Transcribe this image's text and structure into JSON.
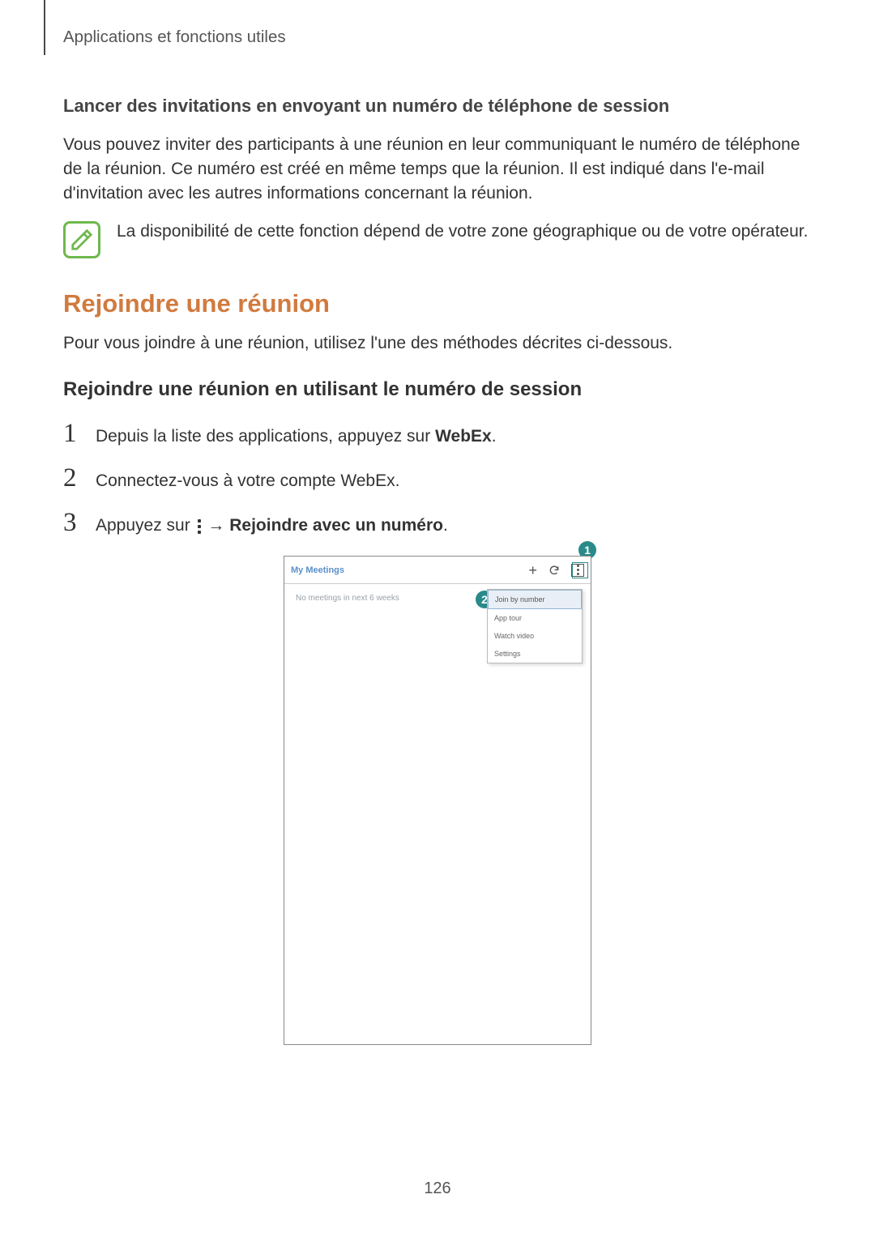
{
  "header": "Applications et fonctions utiles",
  "section1": {
    "title": "Lancer des invitations en envoyant un numéro de téléphone de session",
    "para": "Vous pouvez inviter des participants à une réunion en leur communiquant le numéro de téléphone de la réunion. Ce numéro est créé en même temps que la réunion. Il est indiqué dans l'e-mail d'invitation avec les autres informations concernant la réunion.",
    "note": "La disponibilité de cette fonction dépend de votre zone géographique ou de votre opérateur."
  },
  "section2": {
    "title": "Rejoindre une réunion",
    "intro": "Pour vous joindre à une réunion, utilisez l'une des méthodes décrites ci-dessous.",
    "subtitle": "Rejoindre une réunion en utilisant le numéro de session",
    "steps": {
      "s1_pre": "Depuis la liste des applications, appuyez sur ",
      "s1_bold": "WebEx",
      "s1_post": ".",
      "s2": "Connectez-vous à votre compte WebEx.",
      "s3_pre": "Appuyez sur ",
      "s3_arrow": " → ",
      "s3_bold": "Rejoindre avec un numéro",
      "s3_post": "."
    }
  },
  "phone": {
    "title": "My Meetings",
    "empty": "No meetings in next 6 weeks",
    "menu": {
      "m1": "Join by number",
      "m2": "App tour",
      "m3": "Watch video",
      "m4": "Settings"
    },
    "callouts": {
      "c1": "1",
      "c2": "2"
    }
  },
  "pagenum": "126"
}
